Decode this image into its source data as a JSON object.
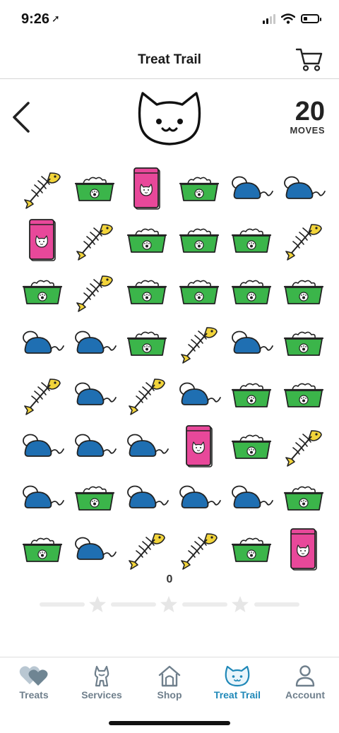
{
  "status": {
    "time": "9:26",
    "location_arrow": "➚",
    "signal_icon": "signal-icon",
    "wifi_icon": "wifi-icon",
    "battery_icon": "battery-icon"
  },
  "nav": {
    "title": "Treat Trail",
    "cart_icon": "cart-icon"
  },
  "header": {
    "back_icon": "chevron-left-icon",
    "mascot_icon": "cat-face-icon",
    "moves_value": "20",
    "moves_label": "MOVES"
  },
  "board": {
    "rows": 8,
    "cols": 6,
    "tiles": [
      [
        "fish",
        "bowl",
        "bag",
        "bowl",
        "mouse",
        "mouse"
      ],
      [
        "bag",
        "fish",
        "bowl",
        "bowl",
        "bowl",
        "fish"
      ],
      [
        "bowl",
        "fish",
        "bowl",
        "bowl",
        "bowl",
        "bowl"
      ],
      [
        "mouse",
        "mouse",
        "bowl",
        "fish",
        "mouse",
        "bowl"
      ],
      [
        "fish",
        "mouse",
        "fish",
        "mouse",
        "bowl",
        "bowl"
      ],
      [
        "mouse",
        "mouse",
        "mouse",
        "bag",
        "bowl",
        "fish"
      ],
      [
        "mouse",
        "bowl",
        "mouse",
        "mouse",
        "mouse",
        "bowl"
      ],
      [
        "bowl",
        "mouse",
        "fish",
        "fish",
        "bowl",
        "bag"
      ]
    ],
    "tile_names": {
      "fish": "fish-bone-treat",
      "bowl": "food-bowl-treat",
      "bag": "food-bag-treat",
      "mouse": "toy-mouse-treat"
    }
  },
  "score": {
    "value": "0",
    "stars_earned": 0,
    "stars_total": 3
  },
  "colors": {
    "accent": "#1f88b8",
    "bowl_green": "#3bb54a",
    "bag_pink": "#e8489a",
    "mouse_blue": "#1f6fb2",
    "fish_yellow": "#f2d43a",
    "tab_inactive": "#6f7f8c"
  },
  "tabs": [
    {
      "label": "Treats",
      "icon": "hearts-icon",
      "active": false
    },
    {
      "label": "Services",
      "icon": "groomed-pet-icon",
      "active": false
    },
    {
      "label": "Shop",
      "icon": "house-icon",
      "active": false
    },
    {
      "label": "Treat Trail",
      "icon": "cat-face-icon",
      "active": true
    },
    {
      "label": "Account",
      "icon": "person-icon",
      "active": false
    }
  ]
}
